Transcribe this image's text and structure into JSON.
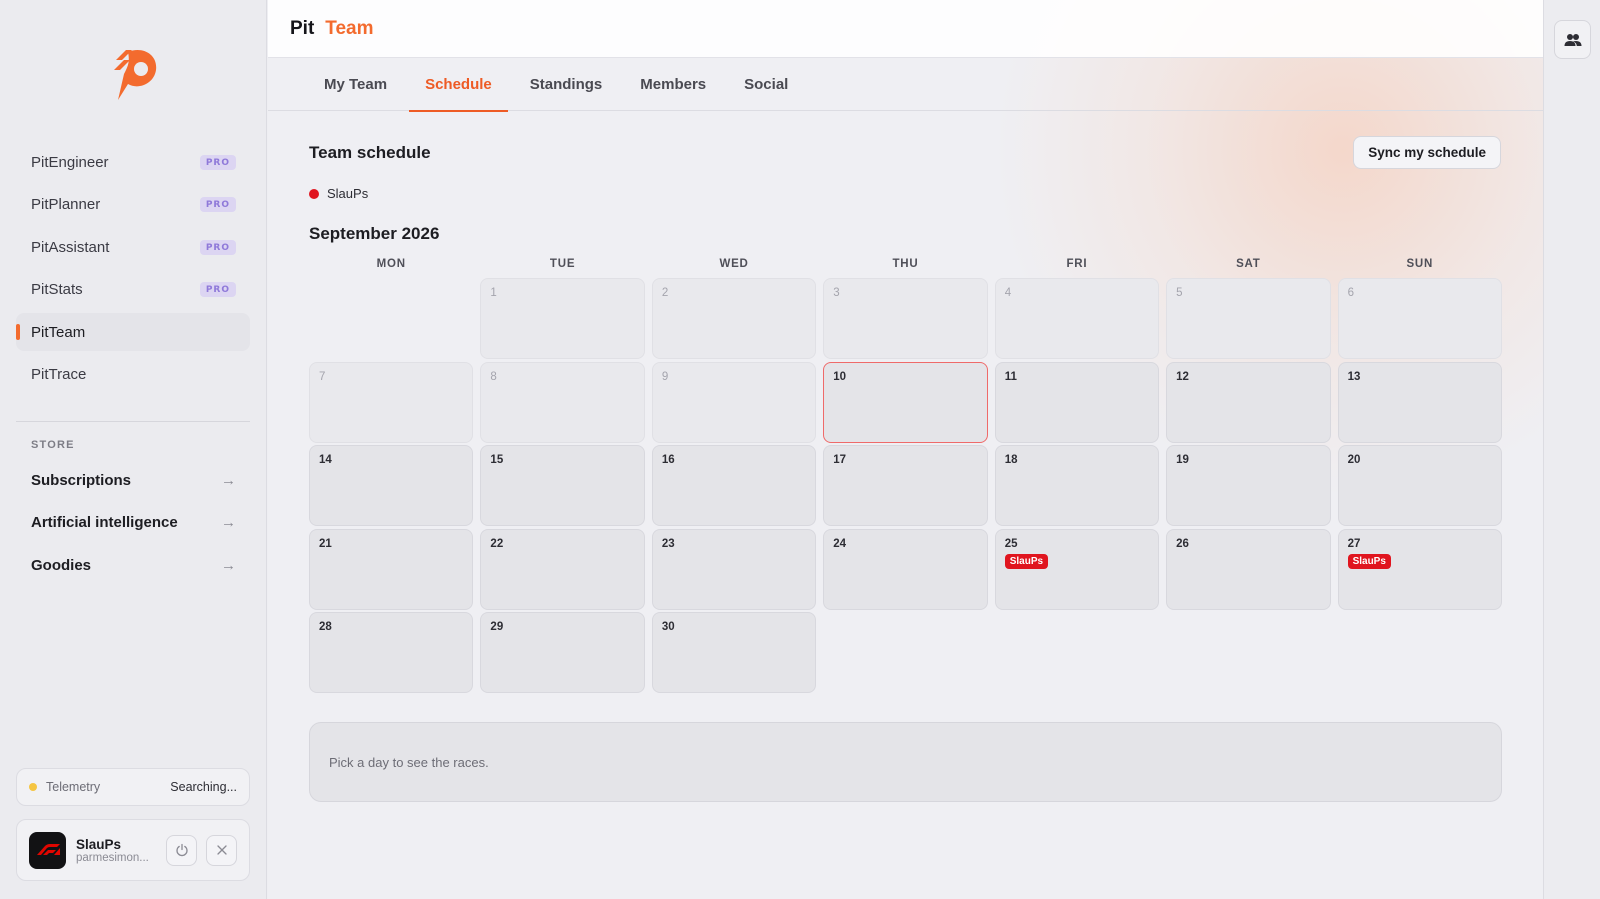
{
  "app": {
    "brand_first": "Pit",
    "brand_second": "Team"
  },
  "sidebar": {
    "items": [
      {
        "label": "PitEngineer",
        "badge": "PRO"
      },
      {
        "label": "PitPlanner",
        "badge": "PRO"
      },
      {
        "label": "PitAssistant",
        "badge": "PRO"
      },
      {
        "label": "PitStats",
        "badge": "PRO"
      },
      {
        "label": "PitTeam",
        "badge": "",
        "active": true
      },
      {
        "label": "PitTrace",
        "badge": ""
      }
    ],
    "store_label": "STORE",
    "store_items": [
      {
        "label": "Subscriptions",
        "arrow": "→"
      },
      {
        "label": "Artificial intelligence",
        "arrow": "→"
      },
      {
        "label": "Goodies",
        "arrow": "→"
      }
    ],
    "telemetry": {
      "label": "Telemetry",
      "status": "Searching..."
    },
    "user": {
      "name": "SlauPs",
      "sub": "parmesimon..."
    }
  },
  "tabs": [
    {
      "label": "My Team"
    },
    {
      "label": "Schedule",
      "active": true
    },
    {
      "label": "Standings"
    },
    {
      "label": "Members"
    },
    {
      "label": "Social"
    }
  ],
  "schedule": {
    "title": "Team schedule",
    "sync_label": "Sync my schedule",
    "legend": [
      {
        "name": "SlauPs",
        "color": "#e0151f"
      }
    ],
    "month_title": "September 2026",
    "weekdays": [
      "MON",
      "TUE",
      "WED",
      "THU",
      "FRI",
      "SAT",
      "SUN"
    ],
    "first_weekday_offset": 1,
    "days_in_month": 30,
    "past_through": 9,
    "today": 10,
    "events": [
      {
        "day": 25,
        "label": "SlauPs"
      },
      {
        "day": 27,
        "label": "SlauPs"
      }
    ],
    "info_text": "Pick a day to see the races."
  },
  "colors": {
    "accent": "#f36b2e",
    "event": "#e0151f",
    "today_border": "#ef6a6a"
  }
}
